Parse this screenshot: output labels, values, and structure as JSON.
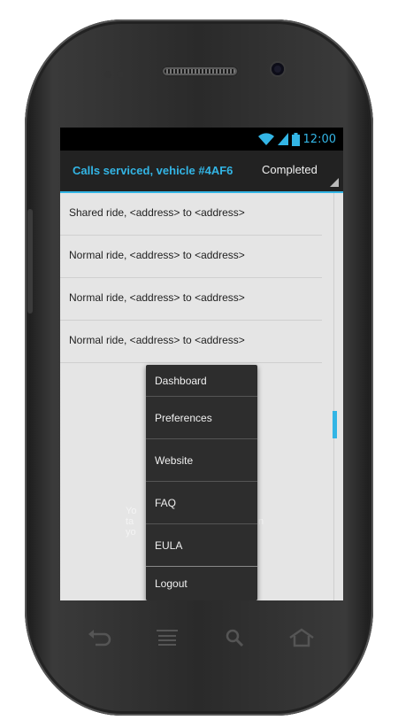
{
  "status": {
    "time": "12:00"
  },
  "action_bar": {
    "title": "Calls serviced, vehicle #4AF6",
    "spinner_value": "Completed"
  },
  "rides": [
    "Shared ride, <address> to <address>",
    "Normal ride, <address> to <address>",
    "Normal ride, <address> to <address>",
    "Normal ride, <address> to <address>"
  ],
  "hint_fragments": [
    "Yo",
    "ta",
    "yo",
    "n"
  ],
  "menu": [
    "Dashboard",
    "Preferences",
    "Website",
    "FAQ",
    "EULA",
    "Logout"
  ],
  "accent_color": "#33b5e5",
  "icons": {
    "status": [
      "wifi-icon",
      "signal-icon",
      "battery-icon"
    ],
    "nav": [
      "back-icon",
      "menu-icon",
      "search-icon",
      "home-icon"
    ]
  }
}
